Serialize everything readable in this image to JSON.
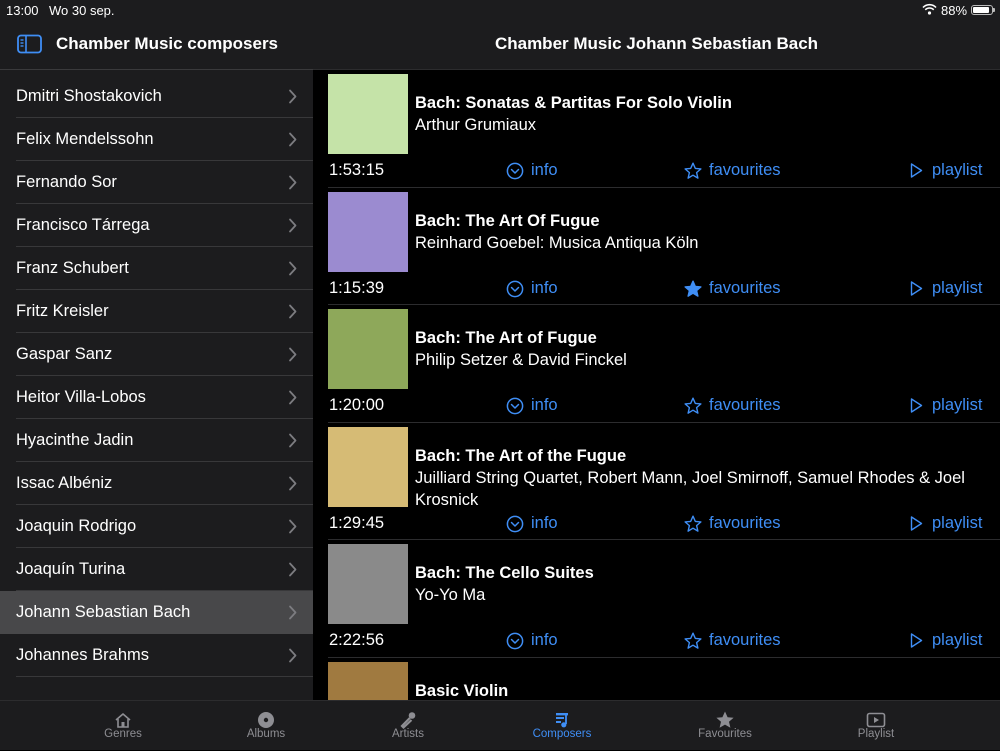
{
  "status": {
    "time": "13:00",
    "date": "Wo 30 sep.",
    "battery_pct": "88%",
    "battery_level": 0.88
  },
  "sidebar": {
    "title": "Chamber Music composers",
    "items": [
      {
        "label": "Dmitri Shostakovich"
      },
      {
        "label": "Felix Mendelssohn"
      },
      {
        "label": "Fernando Sor"
      },
      {
        "label": "Francisco Tárrega"
      },
      {
        "label": "Franz Schubert"
      },
      {
        "label": "Fritz Kreisler"
      },
      {
        "label": "Gaspar Sanz"
      },
      {
        "label": "Heitor Villa-Lobos"
      },
      {
        "label": "Hyacinthe Jadin"
      },
      {
        "label": "Issac Albéniz"
      },
      {
        "label": "Joaquin Rodrigo"
      },
      {
        "label": "Joaquín Turina"
      },
      {
        "label": "Johann Sebastian Bach",
        "selected": true
      },
      {
        "label": "Johannes Brahms"
      }
    ]
  },
  "main": {
    "title": "Chamber Music Johann Sebastian Bach",
    "albums": [
      {
        "title": "Bach: Sonatas & Partitas For Solo Violin",
        "artist": "Arthur Grumiaux",
        "duration": "1:53:15",
        "cover_color": "#c5e3a8",
        "favourite": false,
        "info_label": "info",
        "fav_label": "favourites",
        "playlist_label": "playlist"
      },
      {
        "title": "Bach: The Art Of Fugue",
        "artist": "Reinhard Goebel: Musica Antiqua Köln",
        "duration": "1:15:39",
        "cover_color": "#9b8bd0",
        "favourite": true,
        "info_label": "info",
        "fav_label": "favourites",
        "playlist_label": "playlist"
      },
      {
        "title": "Bach: The Art of Fugue",
        "artist": "Philip Setzer & David Finckel",
        "duration": "1:20:00",
        "cover_color": "#8ea85a",
        "favourite": false,
        "info_label": "info",
        "fav_label": "favourites",
        "playlist_label": "playlist"
      },
      {
        "title": "Bach: The Art of the Fugue",
        "artist": "Juilliard String Quartet, Robert Mann, Joel Smirnoff, Samuel Rhodes & Joel Krosnick",
        "duration": "1:29:45",
        "cover_color": "#d6bb75",
        "favourite": false,
        "info_label": "info",
        "fav_label": "favourites",
        "playlist_label": "playlist"
      },
      {
        "title": "Bach: The Cello Suites",
        "artist": "Yo-Yo Ma",
        "duration": "2:22:56",
        "cover_color": "#8a8a8a",
        "favourite": false,
        "info_label": "info",
        "fav_label": "favourites",
        "playlist_label": "playlist"
      },
      {
        "title": "Basic Violin",
        "artist": "",
        "duration": "",
        "cover_color": "#a07a40",
        "favourite": false,
        "info_label": "",
        "fav_label": "",
        "playlist_label": ""
      }
    ]
  },
  "tabbar": {
    "tabs": [
      {
        "label": "Genres",
        "icon": "house-icon"
      },
      {
        "label": "Albums",
        "icon": "disc-icon"
      },
      {
        "label": "Artists",
        "icon": "microphone-icon"
      },
      {
        "label": "Composers",
        "icon": "music-notes-icon",
        "active": true
      },
      {
        "label": "Favourites",
        "icon": "star-icon"
      },
      {
        "label": "Playlist",
        "icon": "play-rectangle-icon"
      }
    ]
  },
  "colors": {
    "accent": "#3f8ef5",
    "sidebar_bg": "#1c1c1e",
    "selected_row": "#48484a"
  }
}
